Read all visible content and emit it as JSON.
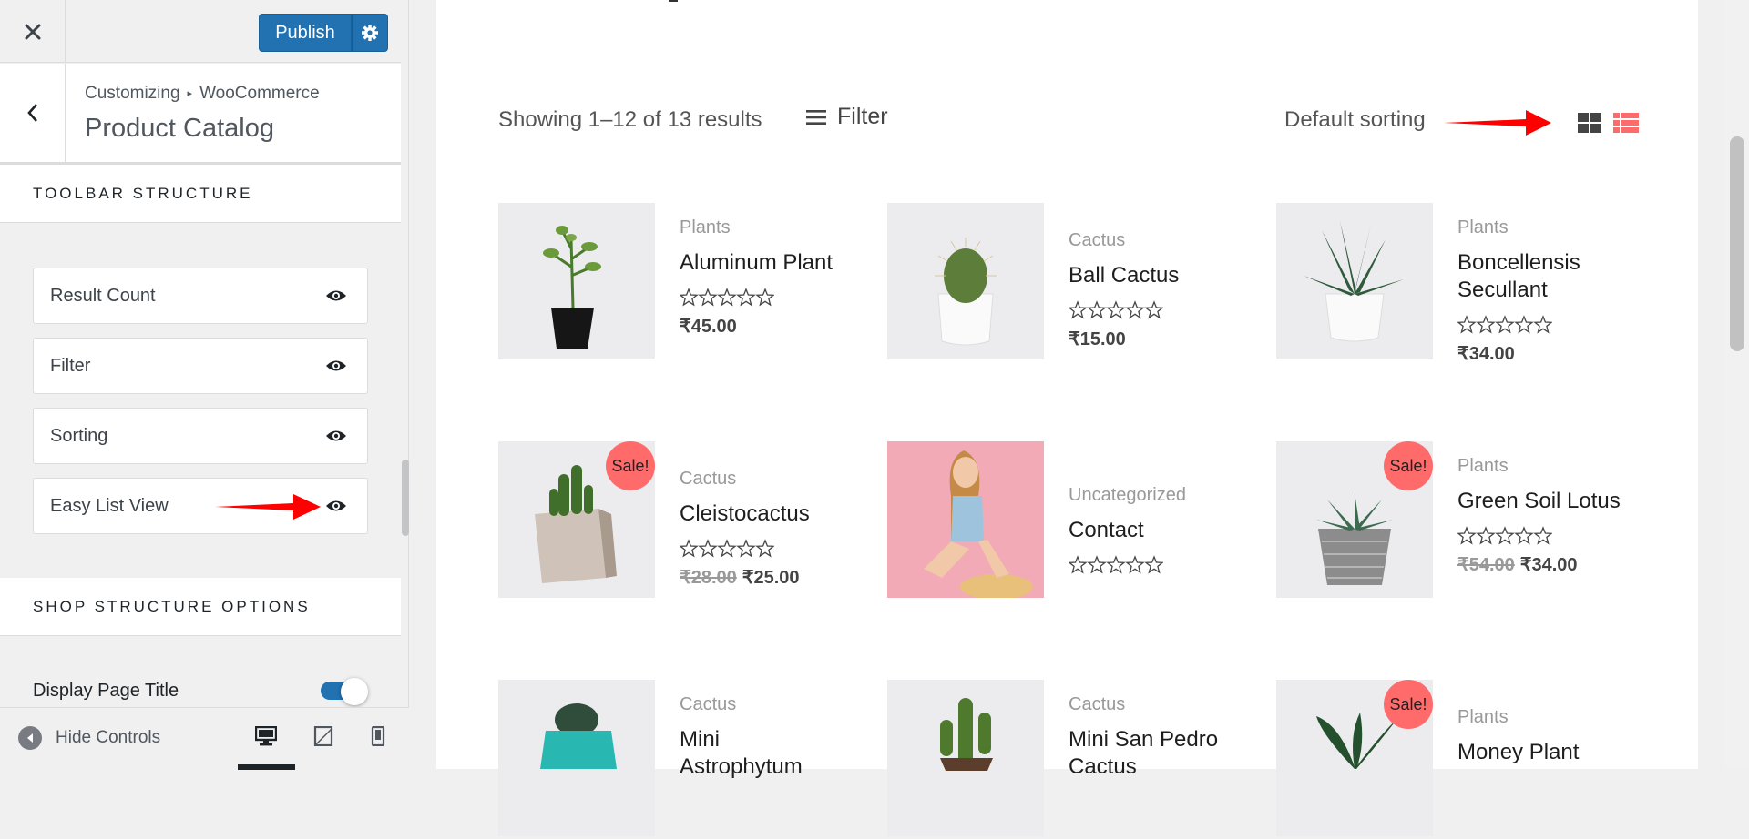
{
  "customizer": {
    "publish_label": "Publish",
    "breadcrumb": {
      "root": "Customizing",
      "section": "WooCommerce"
    },
    "panel_title": "Product Catalog",
    "toolbar_structure_title": "TOOLBAR STRUCTURE",
    "toolbar_items": [
      "Result Count",
      "Filter",
      "Sorting",
      "Easy List View"
    ],
    "shop_structure_title": "SHOP STRUCTURE OPTIONS",
    "display_page_title": {
      "label": "Display Page Title",
      "enabled": true
    },
    "hide_controls_label": "Hide Controls",
    "active_device": "desktop"
  },
  "shop": {
    "result_count": "Showing 1–12 of 13 results",
    "filter_label": "Filter",
    "sorting_label": "Default sorting",
    "view_mode": "grid",
    "products": [
      {
        "category": "Plants",
        "name": "Aluminum Plant",
        "price": "₹45.00",
        "old_price": "",
        "sale": false
      },
      {
        "category": "Cactus",
        "name": "Ball Cactus",
        "price": "₹15.00",
        "old_price": "",
        "sale": false
      },
      {
        "category": "Plants",
        "name": "Boncellensis Secullant",
        "price": "₹34.00",
        "old_price": "",
        "sale": false
      },
      {
        "category": "Cactus",
        "name": "Cleistocactus",
        "price": "₹25.00",
        "old_price": "₹28.00",
        "sale": true
      },
      {
        "category": "Uncategorized",
        "name": "Contact",
        "price": "",
        "old_price": "",
        "sale": false
      },
      {
        "category": "Plants",
        "name": "Green Soil Lotus",
        "price": "₹34.00",
        "old_price": "₹54.00",
        "sale": true
      },
      {
        "category": "Cactus",
        "name": "Mini Astrophytum",
        "price": "",
        "old_price": "",
        "sale": false
      },
      {
        "category": "Cactus",
        "name": "Mini San Pedro Cactus",
        "price": "",
        "old_price": "",
        "sale": false
      },
      {
        "category": "Plants",
        "name": "Money Plant",
        "price": "",
        "old_price": "",
        "sale": true
      }
    ],
    "sale_badge": "Sale!"
  },
  "colors": {
    "accent": "#2271b1",
    "sale": "#ff6b6b",
    "annotation_arrow": "#ff0000",
    "list_icon": "#ff6b6b"
  }
}
